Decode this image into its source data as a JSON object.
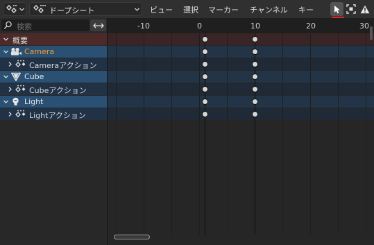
{
  "header": {
    "mode_label": "ドープシート",
    "menus": [
      "ビュー",
      "選択",
      "マーカー",
      "チャンネル",
      "キー"
    ]
  },
  "channels": {
    "search_placeholder": "検索",
    "rows": [
      {
        "label": "概要",
        "kind": "summary",
        "color": "#d8d8d8"
      },
      {
        "label": "Camera",
        "kind": "object",
        "color": "#f0a030",
        "icon": "camera-icon"
      },
      {
        "label": "Cameraアクション",
        "kind": "action",
        "color": "#d8d8d8"
      },
      {
        "label": "Cube",
        "kind": "object",
        "color": "#e8e8e8",
        "icon": "cone-mesh-icon"
      },
      {
        "label": "Cubeアクション",
        "kind": "action",
        "color": "#d8d8d8"
      },
      {
        "label": "Light",
        "kind": "object",
        "color": "#e8e8e8",
        "icon": "bulb-icon"
      },
      {
        "label": "Lightアクション",
        "kind": "action",
        "color": "#d8d8d8"
      }
    ]
  },
  "timeline": {
    "ticks": [
      "-10",
      "0",
      "10",
      "20",
      "30"
    ],
    "tick_values": [
      -10,
      0,
      10,
      20,
      30
    ],
    "current_frame": 1,
    "keyframes": [
      1,
      10
    ]
  },
  "colors": {
    "summary_row": "#4d2a2a",
    "object_row": "#2a5074",
    "action_row": "#213246",
    "accent_red": "#e8222c",
    "object_label_selected": "#f0a030"
  }
}
